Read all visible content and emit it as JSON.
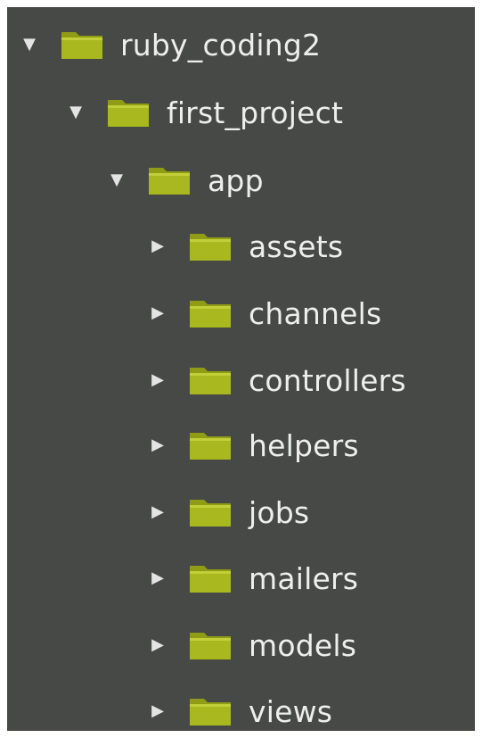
{
  "icons": {
    "expanded": "▼",
    "collapsed": "▶",
    "folder": "folder-icon"
  },
  "colors": {
    "panel_bg": "#474946",
    "folder_fill": "#a9b81e",
    "folder_light": "#c2cf3a",
    "text": "#eeeeee"
  },
  "tree": {
    "root": {
      "label": "ruby_coding2",
      "state": "expanded"
    },
    "project": {
      "label": "first_project",
      "state": "expanded"
    },
    "app": {
      "label": "app",
      "state": "expanded"
    },
    "children": [
      {
        "label": "assets",
        "state": "collapsed"
      },
      {
        "label": "channels",
        "state": "collapsed"
      },
      {
        "label": "controllers",
        "state": "collapsed"
      },
      {
        "label": "helpers",
        "state": "collapsed"
      },
      {
        "label": "jobs",
        "state": "collapsed"
      },
      {
        "label": "mailers",
        "state": "collapsed"
      },
      {
        "label": "models",
        "state": "collapsed"
      },
      {
        "label": "views",
        "state": "collapsed"
      }
    ]
  }
}
